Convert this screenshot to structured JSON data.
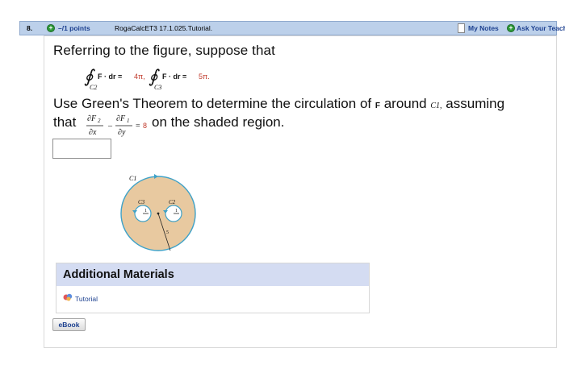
{
  "header": {
    "number": "8.",
    "points": "–/1 points",
    "source": "RogaCalcET3 17.1.025.Tutorial.",
    "my_notes": "My Notes",
    "ask_teacher": "Ask Your Teacher"
  },
  "question": {
    "line1": "Referring to the figure, suppose that",
    "integral1": {
      "lhs": "F · dr =",
      "rhs": "4π,",
      "sub": "C2"
    },
    "integral2": {
      "lhs": "F · dr =",
      "rhs": "5π.",
      "sub": "C3"
    },
    "line2_pre": "Use Green's Theorem to determine the circulation of",
    "line2_F": "F",
    "line2_mid": "around",
    "line2_C": "C1,",
    "line2_post": "assuming",
    "line3_pre": "that",
    "condition_value": "8",
    "line3_post": "on the shaded region."
  },
  "answer": {
    "value": ""
  },
  "figure": {
    "label_c1": "C1",
    "label_c2": "C2",
    "label_c3": "C3",
    "tick_1a": "1",
    "tick_1b": "1",
    "radius_label": "5"
  },
  "materials": {
    "title": "Additional Materials",
    "tutorial": "Tutorial"
  },
  "ebook": {
    "label": "eBook"
  },
  "colors": {
    "header_bg": "#bcd0ea",
    "link": "#1b3f8f",
    "highlight_red": "#c0392b",
    "region_fill": "#e8c9a0",
    "materials_bg": "#d4dcf2"
  }
}
